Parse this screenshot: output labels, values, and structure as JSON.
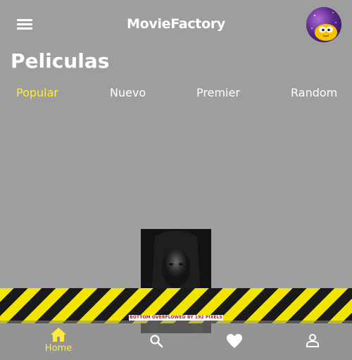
{
  "app": {
    "title": "MovieFactory"
  },
  "page": {
    "title": "Peliculas"
  },
  "tabs": [
    {
      "label": "Popular",
      "active": true
    },
    {
      "label": "Nuevo",
      "active": false
    },
    {
      "label": "Premier",
      "active": false
    },
    {
      "label": "Random",
      "active": false
    }
  ],
  "overflow_warning": "BOTTOM OVERFLOWED BY 192 PIXELS",
  "bottom_nav": {
    "items": [
      {
        "icon": "home-icon",
        "label": "Home",
        "active": true
      },
      {
        "icon": "search-icon",
        "label": "",
        "active": false
      },
      {
        "icon": "heart-icon",
        "label": "",
        "active": false
      },
      {
        "icon": "person-icon",
        "label": "",
        "active": false
      }
    ]
  },
  "colors": {
    "accent": "#ffeb3b",
    "background": "#9e9e9e",
    "text": "#ffffff"
  }
}
